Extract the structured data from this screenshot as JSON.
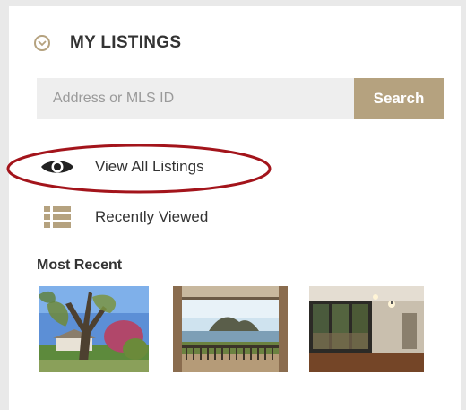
{
  "widget": {
    "title": "MY LISTINGS",
    "toggle_icon": "chevron-down-circle-icon"
  },
  "search": {
    "placeholder": "Address or MLS ID",
    "value": "",
    "button_label": "Search"
  },
  "nav": {
    "items": [
      {
        "label": "View All Listings",
        "icon": "eye-icon"
      },
      {
        "label": "Recently Viewed",
        "icon": "list-icon"
      }
    ]
  },
  "most_recent": {
    "title": "Most Recent",
    "thumbnails": [
      {
        "icon": "listing-photo-tree-house"
      },
      {
        "icon": "listing-photo-lake-view-deck"
      },
      {
        "icon": "listing-photo-interior-room"
      }
    ]
  },
  "colors": {
    "accent": "#b5a27f",
    "text": "#333333",
    "annotation": "#a3141b",
    "input_bg": "#eeeeee"
  }
}
